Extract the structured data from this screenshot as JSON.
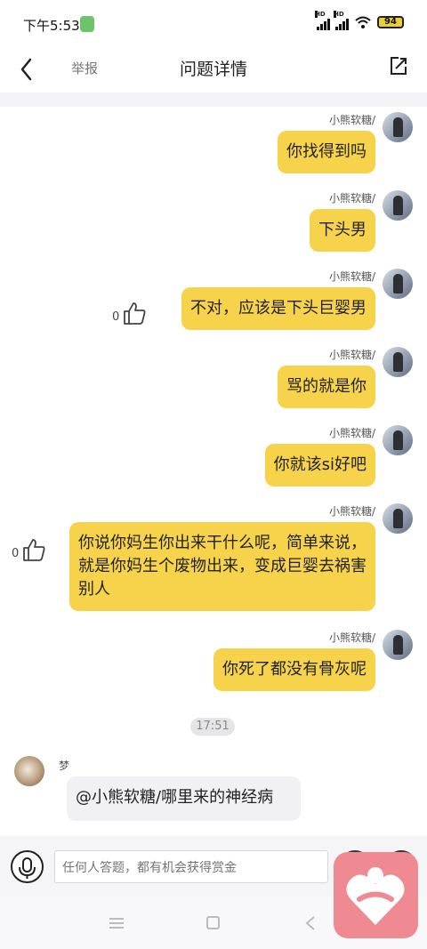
{
  "status_bar": {
    "time": "下午5:53",
    "signal_label_1": "HD",
    "signal_label_2": "HD",
    "battery": "94"
  },
  "header": {
    "back_icon": "chevron-left-icon",
    "report": "举报",
    "title": "问题详情",
    "share_icon": "share-icon"
  },
  "messages": [
    {
      "sender": "小熊软糖/",
      "text": "你找得到吗"
    },
    {
      "sender": "小熊软糖/",
      "text": "下头男"
    },
    {
      "sender": "小熊软糖/",
      "text": "不对，应该是下头巨婴男",
      "likes": "0"
    },
    {
      "sender": "小熊软糖/",
      "text": "骂的就是你"
    },
    {
      "sender": "小熊软糖/",
      "text": "你就该si好吧"
    },
    {
      "sender": "小熊软糖/",
      "text": "你说你妈生你出来干什么呢，简单来说，就是你妈生个废物出来，变成巨婴去祸害别人",
      "likes": "0"
    },
    {
      "sender": "小熊软糖/",
      "text": "你死了都没有骨灰呢"
    }
  ],
  "timestamp": "17:51",
  "other_message": {
    "sender": "梦",
    "text": "@小熊软糖/哪里来的神经病"
  },
  "reply_bar": {
    "placeholder": "任何人答题，都有机会获得赏金",
    "mic_icon": "microphone-icon",
    "emoji_icon": "emoji-icon",
    "add_icon": "plus-icon"
  },
  "floating_button": {
    "icon": "heart-person-icon",
    "color": "#ef8a93"
  },
  "accent_color": "#f6d34a"
}
